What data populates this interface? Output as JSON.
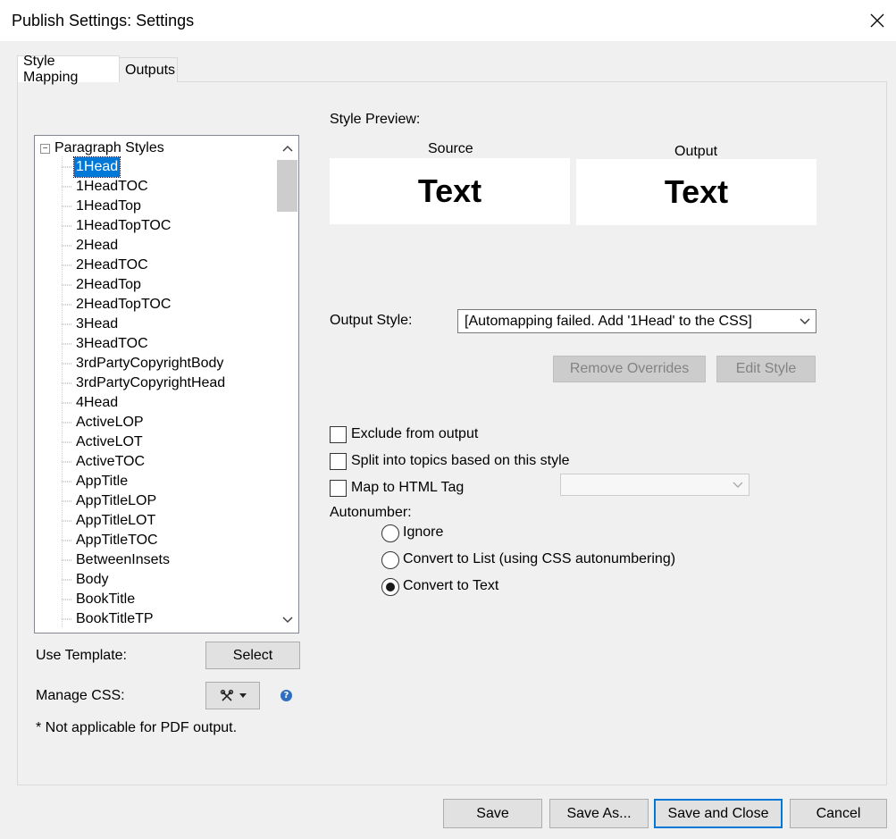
{
  "window": {
    "title": "Publish Settings: Settings"
  },
  "tabs": [
    {
      "label": "Style Mapping"
    },
    {
      "label": "Outputs"
    }
  ],
  "tree": {
    "root_label": "Paragraph Styles",
    "selected_index": 0,
    "items": [
      "1Head",
      "1HeadTOC",
      "1HeadTop",
      "1HeadTopTOC",
      "2Head",
      "2HeadTOC",
      "2HeadTop",
      "2HeadTopTOC",
      "3Head",
      "3HeadTOC",
      "3rdPartyCopyrightBody",
      "3rdPartyCopyrightHead",
      "4Head",
      "ActiveLOP",
      "ActiveLOT",
      "ActiveTOC",
      "AppTitle",
      "AppTitleLOP",
      "AppTitleLOT",
      "AppTitleTOC",
      "BetweenInsets",
      "Body",
      "BookTitle",
      "BookTitleTP"
    ]
  },
  "left_panel": {
    "use_template_label": "Use Template:",
    "select_button": "Select",
    "manage_css_label": "Manage CSS:",
    "note": "* Not applicable for PDF output."
  },
  "preview": {
    "heading": "Style Preview:",
    "source_label": "Source",
    "output_label": "Output",
    "source_text": "Text",
    "output_text": "Text"
  },
  "output_style": {
    "label": "Output Style:",
    "value": "[Automapping failed. Add '1Head' to the CSS]",
    "remove_overrides": "Remove Overrides",
    "edit_style": "Edit Style"
  },
  "options": {
    "exclude": {
      "label": "Exclude from output",
      "checked": false
    },
    "split": {
      "label": "Split into topics based on this style",
      "checked": false
    },
    "map_tag": {
      "label": "Map to HTML Tag",
      "checked": false,
      "value": ""
    }
  },
  "autonumber": {
    "label": "Autonumber:",
    "options": [
      {
        "label": "Ignore",
        "selected": false
      },
      {
        "label": "Convert to List (using CSS autonumbering)",
        "selected": false
      },
      {
        "label": "Convert to Text",
        "selected": true
      }
    ]
  },
  "footer": {
    "save": "Save",
    "save_as": "Save As...",
    "save_close": "Save and Close",
    "cancel": "Cancel"
  },
  "icons": {
    "close": "close-icon",
    "tree_toggle": "collapse-minus-icon",
    "manage_css": "tools-icon",
    "help": "help-icon"
  },
  "colors": {
    "selection": "#0078d7",
    "help": "#2f6fc2"
  }
}
